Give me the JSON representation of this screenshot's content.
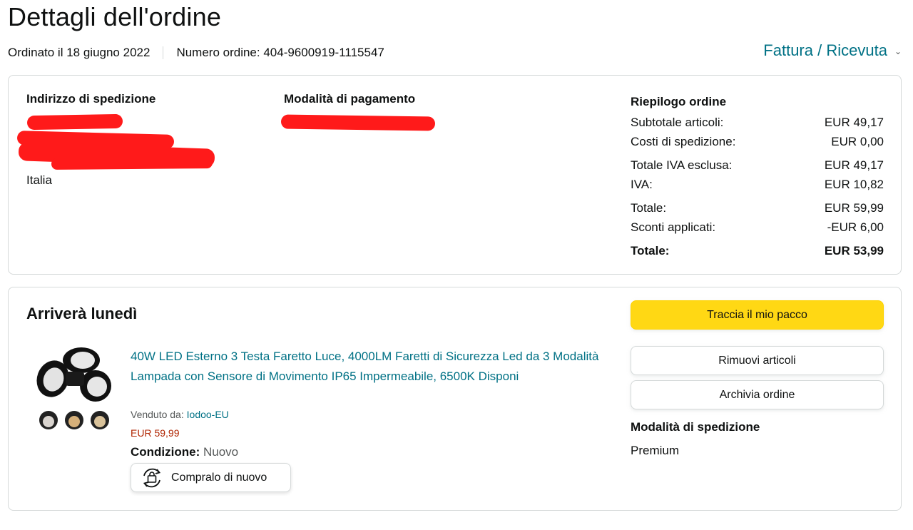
{
  "header": {
    "title": "Dettagli dell'ordine",
    "ordered_on": "Ordinato il 18 giugno 2022",
    "order_number": "Numero ordine: 404-9600919-1115547",
    "invoice_link": "Fattura / Ricevuta"
  },
  "shipping_address": {
    "title": "Indirizzo di spedizione",
    "country": "Italia"
  },
  "payment": {
    "title": "Modalità di pagamento"
  },
  "summary": {
    "title": "Riepilogo ordine",
    "rows": [
      {
        "label": "Subtotale articoli:",
        "value": "EUR 49,17"
      },
      {
        "label": "Costi di spedizione:",
        "value": "EUR 0,00"
      },
      {
        "label": "Totale IVA esclusa:",
        "value": "EUR 49,17"
      },
      {
        "label": "IVA:",
        "value": "EUR 10,82"
      },
      {
        "label": "Totale:",
        "value": "EUR 59,99"
      },
      {
        "label": "Sconti applicati:",
        "value": "-EUR 6,00"
      },
      {
        "label": "Totale:",
        "value": "EUR 53,99"
      }
    ]
  },
  "shipment": {
    "arrival": "Arriverà lunedì",
    "product_title": "40W LED Esterno 3 Testa Faretto Luce, 4000LM Faretti di Sicurezza Led da 3 Modalità Lampada con Sensore di Movimento IP65 Impermeabile, 6500K Disponi",
    "sold_by_label": "Venduto da: ",
    "seller": "Iodoo-EU",
    "price": "EUR 59,99",
    "condition_label": "Condizione:",
    "condition_value": " Nuovo",
    "buy_again": "Compralo di nuovo",
    "track_button": "Traccia il mio pacco",
    "remove_button": "Rimuovi articoli",
    "archive_button": "Archivia ordine",
    "shipping_method_title": "Modalità di spedizione",
    "shipping_method": "Premium"
  },
  "colors": {
    "link": "#007185",
    "price": "#b12704",
    "primary_button": "#ffd814",
    "redaction": "#ff1a1a"
  }
}
